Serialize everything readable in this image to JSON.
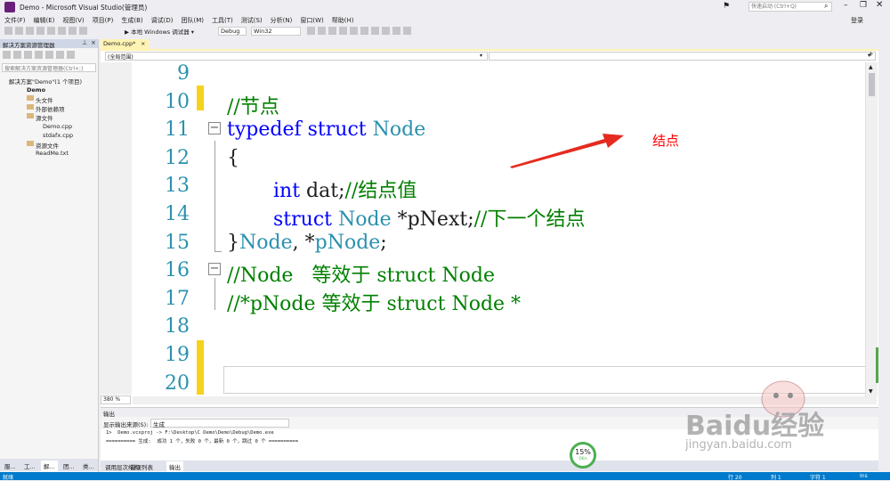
{
  "window": {
    "title": "Demo - Microsoft Visual Studio(管理员)",
    "quick_launch": "快速启动 (Ctrl+Q)",
    "login": "登录"
  },
  "menu": [
    "文件(F)",
    "编辑(E)",
    "视图(V)",
    "项目(P)",
    "生成(B)",
    "调试(D)",
    "团队(M)",
    "工具(T)",
    "测试(S)",
    "分析(N)",
    "窗口(W)",
    "帮助(H)"
  ],
  "toolbar": {
    "debugger": "▶ 本地 Windows 调试器 ▾",
    "config": "Debug",
    "platform": "Win32"
  },
  "solution_explorer": {
    "title": "解决方案资源管理器",
    "search_placeholder": "搜索解决方案资源管理器(Ctrl+;)",
    "items": [
      "解决方案\"Demo\"(1 个项目)",
      "Demo",
      "头文件",
      "外部依赖项",
      "源文件",
      "Demo.cpp",
      "stdafx.cpp",
      "资源文件",
      "ReadMe.txt"
    ],
    "bottom_tabs": [
      "服...",
      "工...",
      "解...",
      "团...",
      "类..."
    ]
  },
  "editor": {
    "tab": "Demo.cpp*",
    "scope": "(全局范围)",
    "zoom": "380 %",
    "lines": [
      {
        "no": "9",
        "text": ""
      },
      {
        "no": "10",
        "text": "//节点"
      },
      {
        "no": "11",
        "text": "typedef struct Node"
      },
      {
        "no": "12",
        "text": "{"
      },
      {
        "no": "13",
        "text": "int dat;//结点值"
      },
      {
        "no": "14",
        "text": "struct Node *pNext;//下一个结点"
      },
      {
        "no": "15",
        "text": "}Node, *pNode;"
      },
      {
        "no": "16",
        "text": "//Node   等效于 struct Node"
      },
      {
        "no": "17",
        "text": "//*pNode 等效于 struct Node *"
      },
      {
        "no": "18",
        "text": ""
      },
      {
        "no": "19",
        "text": ""
      },
      {
        "no": "20",
        "text": ""
      }
    ],
    "annotation": "结点",
    "colors": {
      "keyword": "#0000ff",
      "type": "#2b91af",
      "comment": "#008000",
      "annotation": "#ff0000"
    }
  },
  "output": {
    "title": "输出",
    "source_label": "显示输出来源(S):",
    "source_value": "生成",
    "line1": "1>  Demo.vcxproj -> F:\\Desktop\\C Demo\\Demo\\Debug\\Demo.exe",
    "line2": "========== 生成:  成功 1 个，失败 0 个，最新 0 个，跳过 0 个 ==========",
    "tabs": [
      "调用层次结构",
      "错误列表",
      "输出"
    ],
    "progress": "15%",
    "progress_sub": "OK/s"
  },
  "status": {
    "ready": "就绪",
    "row": "行 20",
    "col": "列 1",
    "char": "字符 1",
    "mode": "Ins"
  },
  "watermark": "Baidu经验",
  "watermark_url": "jingyan.baidu.com"
}
